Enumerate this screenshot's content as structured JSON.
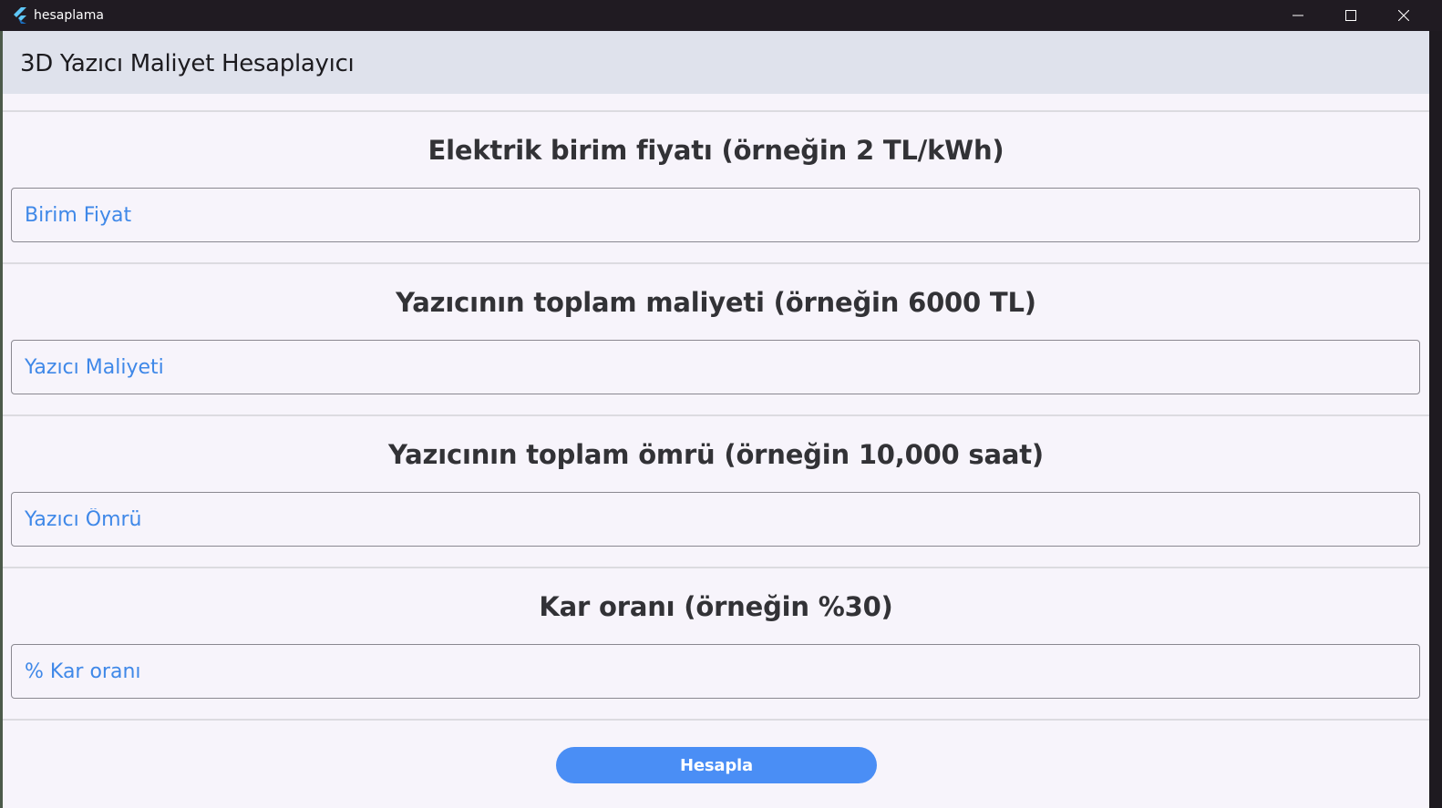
{
  "window": {
    "title": "hesaplama",
    "icon": "flutter-logo-icon",
    "controls": [
      "minimize-icon",
      "maximize-icon",
      "close-icon"
    ]
  },
  "appbar": {
    "title": "3D Yazıcı Maliyet Hesaplayıcı"
  },
  "sections": [
    {
      "label": "Elektrik birim fiyatı (örneğin 2 TL/kWh)",
      "placeholder": "Birim Fiyat",
      "value": ""
    },
    {
      "label": "Yazıcının toplam maliyeti (örneğin 6000 TL)",
      "placeholder": "Yazıcı Maliyeti",
      "value": ""
    },
    {
      "label": "Yazıcının toplam ömrü (örneğin 10,000 saat)",
      "placeholder": "Yazıcı Ömrü",
      "value": ""
    },
    {
      "label": "Kar oranı (örneğin %30)",
      "placeholder": "% Kar oranı",
      "value": ""
    }
  ],
  "button": {
    "label": "Hesapla"
  },
  "colors": {
    "titlebar": "#201b22",
    "appbar": "#dfe2ec",
    "background": "#f7f4fb",
    "accent": "#4a8ef5",
    "placeholder": "#3f88e8"
  }
}
